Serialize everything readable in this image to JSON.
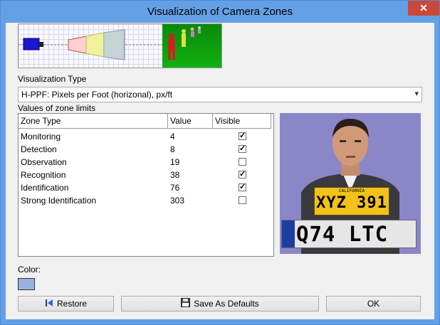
{
  "window": {
    "title": "Visualization of Camera Zones",
    "close_glyph": "✕"
  },
  "visualization_type": {
    "label": "Visualization Type",
    "selected": "H-PPF: Pixels per Foot (horizonal), px/ft"
  },
  "zones": {
    "label": "Values of zone limits",
    "columns": [
      "Zone Type",
      "Value",
      "Visible"
    ],
    "rows": [
      {
        "zone": "Monitoring",
        "value": "4",
        "visible": true
      },
      {
        "zone": "Detection",
        "value": "8",
        "visible": true
      },
      {
        "zone": "Observation",
        "value": "19",
        "visible": false
      },
      {
        "zone": "Recognition",
        "value": "38",
        "visible": true
      },
      {
        "zone": "Identification",
        "value": "76",
        "visible": true
      },
      {
        "zone": "Strong Identification",
        "value": "303",
        "visible": false
      }
    ]
  },
  "sample_image": {
    "plate_small": "XYZ 391",
    "plate_small_header": "CALIFORNIA",
    "plate_large": "Q74 LTC"
  },
  "color": {
    "label": "Color:",
    "swatch": "#9bb0de"
  },
  "buttons": {
    "restore": "Restore",
    "save_defaults": "Save As Defaults",
    "ok": "OK"
  },
  "icons": {
    "restore": "restore-icon",
    "save": "floppy-disk-icon"
  }
}
